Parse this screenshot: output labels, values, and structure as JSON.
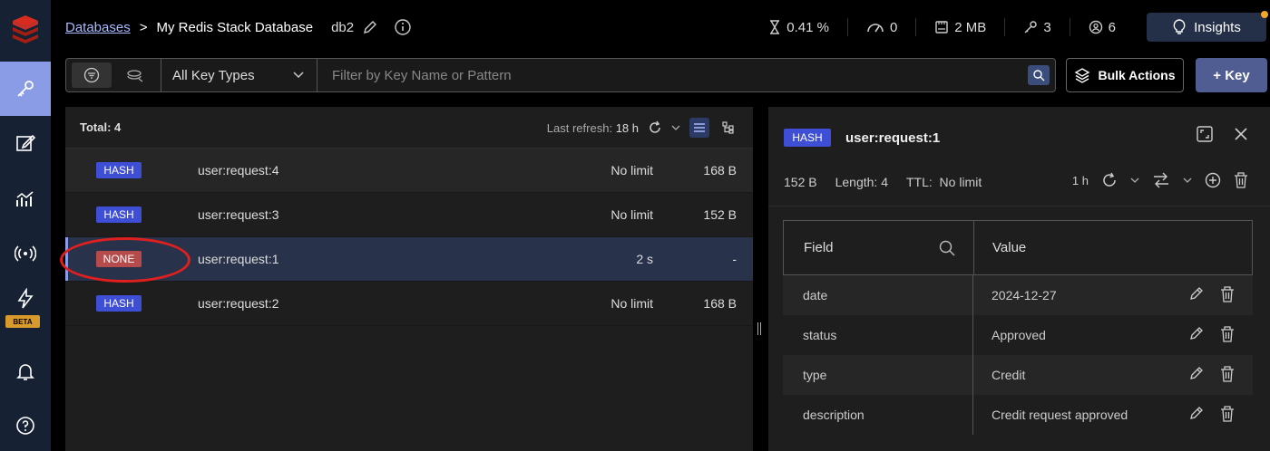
{
  "breadcrumb": {
    "databases_label": "Databases",
    "separator": ">",
    "database_name": "My Redis Stack Database",
    "db_index": "db2"
  },
  "stats": {
    "cpu": "0.41 %",
    "ops": "0",
    "memory": "2 MB",
    "keys": "3",
    "clients": "6"
  },
  "insights_label": "Insights",
  "sidebar": {
    "beta_label": "BETA",
    "items": [
      "browser-icon",
      "workbench-icon",
      "analytics-icon",
      "pubsub-icon",
      "triggers-icon",
      "notifications-icon",
      "help-icon"
    ]
  },
  "filter": {
    "key_type": "All Key Types",
    "placeholder": "Filter by Key Name or Pattern"
  },
  "actions": {
    "bulk_label": "Bulk Actions",
    "add_key_label": "+ Key"
  },
  "key_list": {
    "total_label": "Total: 4",
    "refresh_label": "Last refresh:",
    "refresh_value": "18 h",
    "rows": [
      {
        "type": "HASH",
        "name": "user:request:4",
        "ttl": "No limit",
        "size": "168 B"
      },
      {
        "type": "HASH",
        "name": "user:request:3",
        "ttl": "No limit",
        "size": "152 B"
      },
      {
        "type": "NONE",
        "name": "user:request:1",
        "ttl": "2 s",
        "size": "-"
      },
      {
        "type": "HASH",
        "name": "user:request:2",
        "ttl": "No limit",
        "size": "168 B"
      }
    ]
  },
  "detail": {
    "type": "HASH",
    "name": "user:request:1",
    "size": "152 B",
    "length": "Length: 4",
    "ttl_label": "TTL:",
    "ttl_value": "No limit",
    "refresh_value": "1 h",
    "columns": {
      "field": "Field",
      "value": "Value"
    },
    "rows": [
      {
        "field": "date",
        "value": "2024-12-27"
      },
      {
        "field": "status",
        "value": "Approved"
      },
      {
        "field": "type",
        "value": "Credit"
      },
      {
        "field": "description",
        "value": "Credit request approved"
      }
    ]
  },
  "colors": {
    "accent": "#8a9ce6",
    "hash_badge": "#3e4fd6",
    "none_badge": "#b54b4b",
    "annotation": "#e01f1f"
  }
}
